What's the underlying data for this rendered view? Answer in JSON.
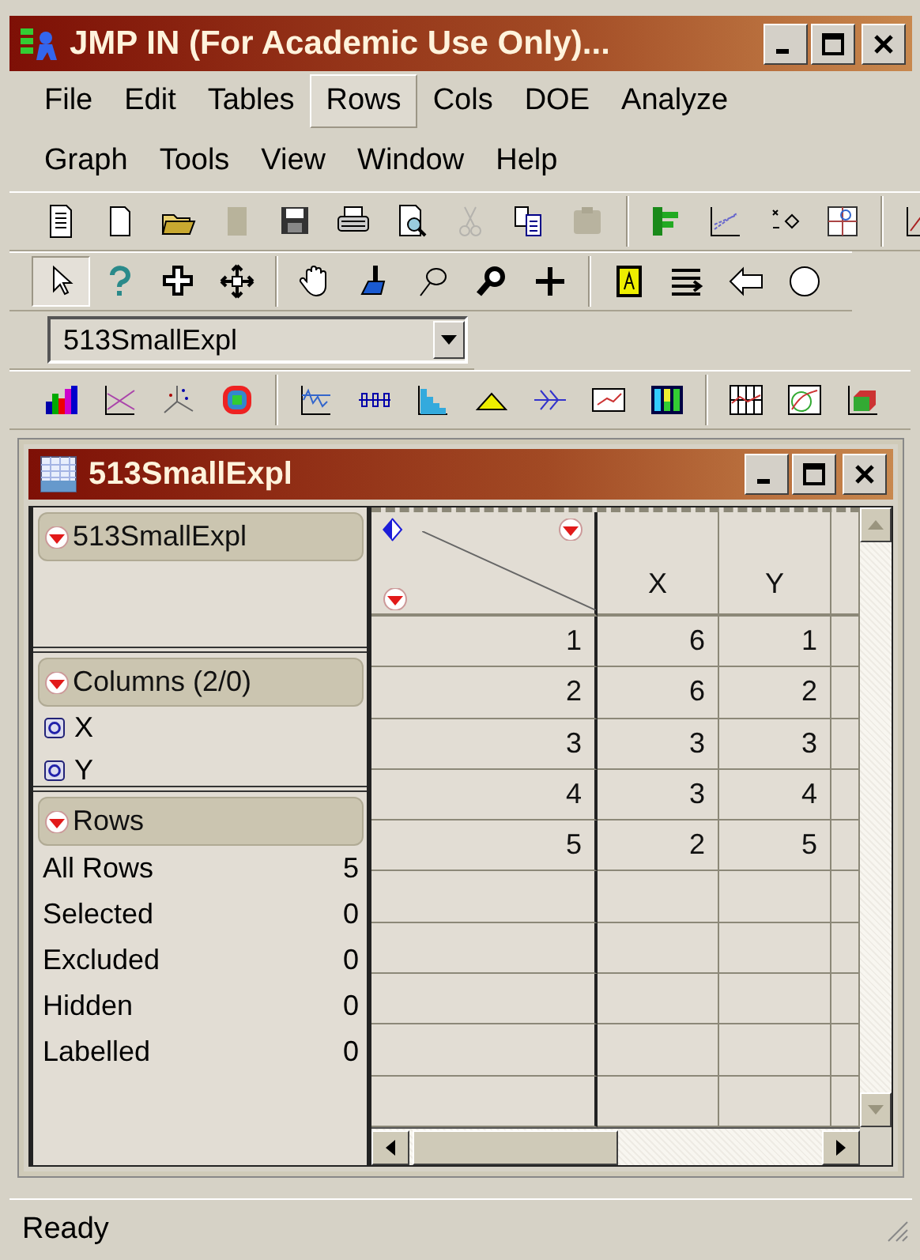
{
  "window": {
    "title": "JMP IN (For Academic Use Only)..."
  },
  "menu": [
    {
      "label": "File",
      "selected": false
    },
    {
      "label": "Edit",
      "selected": false
    },
    {
      "label": "Tables",
      "selected": false
    },
    {
      "label": "Rows",
      "selected": true
    },
    {
      "label": "Cols",
      "selected": false
    },
    {
      "label": "DOE",
      "selected": false
    },
    {
      "label": "Analyze",
      "selected": false
    },
    {
      "label": "Graph",
      "selected": false
    },
    {
      "label": "Tools",
      "selected": false
    },
    {
      "label": "View",
      "selected": false
    },
    {
      "label": "Window",
      "selected": false
    },
    {
      "label": "Help",
      "selected": false
    }
  ],
  "file_toolbar": [
    {
      "disabled": false
    },
    {
      "disabled": false
    },
    {
      "disabled": false
    },
    {
      "disabled": true
    },
    {
      "disabled": false
    },
    {
      "disabled": false
    },
    {
      "disabled": false
    },
    {
      "disabled": true
    },
    {
      "disabled": false
    },
    {
      "disabled": true
    },
    {
      "disabled": false
    },
    {
      "disabled": false
    },
    {
      "disabled": false
    },
    {
      "disabled": false
    },
    {
      "disabled": false
    }
  ],
  "tools_toolbar": [
    {
      "selected": true
    },
    {
      "selected": false
    },
    {
      "selected": false
    },
    {
      "selected": false
    },
    {
      "selected": false
    },
    {
      "selected": false
    },
    {
      "selected": false
    },
    {
      "selected": false
    },
    {
      "selected": false
    },
    {
      "selected": false
    },
    {
      "selected": false
    },
    {
      "selected": false
    },
    {
      "selected": false
    }
  ],
  "table_selector": {
    "value": "513SmallExpl"
  },
  "data_window": {
    "title": "513SmallExpl",
    "table_panel": {
      "title": "513SmallExpl"
    },
    "columns_panel": {
      "title": "Columns (2/0)",
      "items": [
        "X",
        "Y"
      ]
    },
    "rows_panel": {
      "title": "Rows",
      "items": [
        {
          "label": "All Rows",
          "count": "5"
        },
        {
          "label": "Selected",
          "count": "0"
        },
        {
          "label": "Excluded",
          "count": "0"
        },
        {
          "label": "Hidden",
          "count": "0"
        },
        {
          "label": "Labelled",
          "count": "0"
        }
      ]
    },
    "table": {
      "columns": [
        "X",
        "Y"
      ],
      "rows": [
        {
          "row": "1",
          "values": [
            "6",
            "1"
          ]
        },
        {
          "row": "2",
          "values": [
            "6",
            "2"
          ]
        },
        {
          "row": "3",
          "values": [
            "3",
            "3"
          ]
        },
        {
          "row": "4",
          "values": [
            "3",
            "4"
          ]
        },
        {
          "row": "5",
          "values": [
            "2",
            "5"
          ]
        }
      ]
    }
  },
  "status_bar": {
    "text": "Ready"
  }
}
